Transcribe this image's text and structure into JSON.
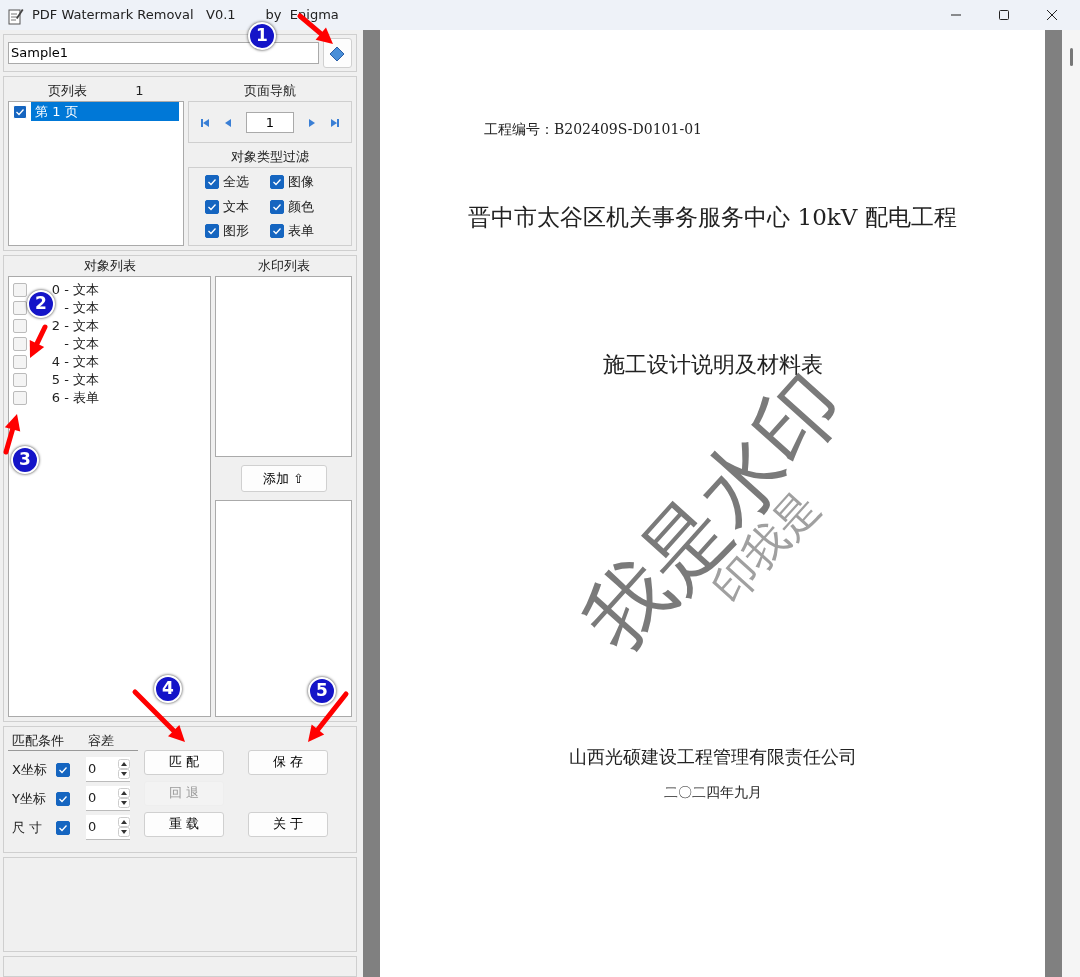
{
  "window": {
    "title": "PDF Watermark Removal   V0.1",
    "author": "by  Enigma"
  },
  "file": {
    "value": "Sample1"
  },
  "page_list": {
    "title": "页列表",
    "count": "1",
    "items": [
      {
        "label": "第 1 页",
        "checked": true,
        "selected": true
      }
    ]
  },
  "page_nav": {
    "title": "页面导航",
    "page": "1"
  },
  "type_filter": {
    "title": "对象类型过滤",
    "items": [
      {
        "label": "全选",
        "checked": true
      },
      {
        "label": "图像",
        "checked": true
      },
      {
        "label": "文本",
        "checked": true
      },
      {
        "label": "颜色",
        "checked": true
      },
      {
        "label": "图形",
        "checked": true
      },
      {
        "label": "表单",
        "checked": true
      }
    ]
  },
  "object_list": {
    "title": "对象列表",
    "items": [
      {
        "label": "0 - 文本",
        "checked": false
      },
      {
        "label": "- 文本",
        "checked": false
      },
      {
        "label": "2 - 文本",
        "checked": false
      },
      {
        "label": "- 文本",
        "checked": false
      },
      {
        "label": "4 - 文本",
        "checked": false
      },
      {
        "label": "5 - 文本",
        "checked": false
      },
      {
        "label": "6 - 表单",
        "checked": false
      }
    ]
  },
  "watermark_list": {
    "title": "水印列表",
    "add_button": "添加 ⇧"
  },
  "match": {
    "columns": [
      "匹配条件",
      "容差"
    ],
    "rows": [
      {
        "label": "X坐标",
        "checked": true,
        "value": "0"
      },
      {
        "label": "Y坐标",
        "checked": true,
        "value": "0"
      },
      {
        "label": "尺 寸",
        "checked": true,
        "value": "0"
      }
    ]
  },
  "buttons": [
    {
      "label": "匹 配",
      "disabled": false
    },
    {
      "label": "保 存",
      "disabled": false
    },
    {
      "label": "回 退",
      "disabled": true
    },
    {
      "label": "重 载",
      "disabled": false
    },
    {
      "label": "关 于",
      "disabled": false
    }
  ],
  "document": {
    "project_no": "工程编号：B202409S-D0101-01",
    "title": "晋中市太谷区机关事务服务中心 10kV 配电工程",
    "subtitle": "施工设计说明及材料表",
    "watermark": "我是水印",
    "watermark_small": "印我是",
    "company": "山西光硕建设工程管理有限责任公司",
    "date": "二〇二四年九月"
  },
  "annotations": [
    {
      "label": "1"
    },
    {
      "label": "2"
    },
    {
      "label": "3"
    },
    {
      "label": "4"
    },
    {
      "label": "5"
    }
  ]
}
